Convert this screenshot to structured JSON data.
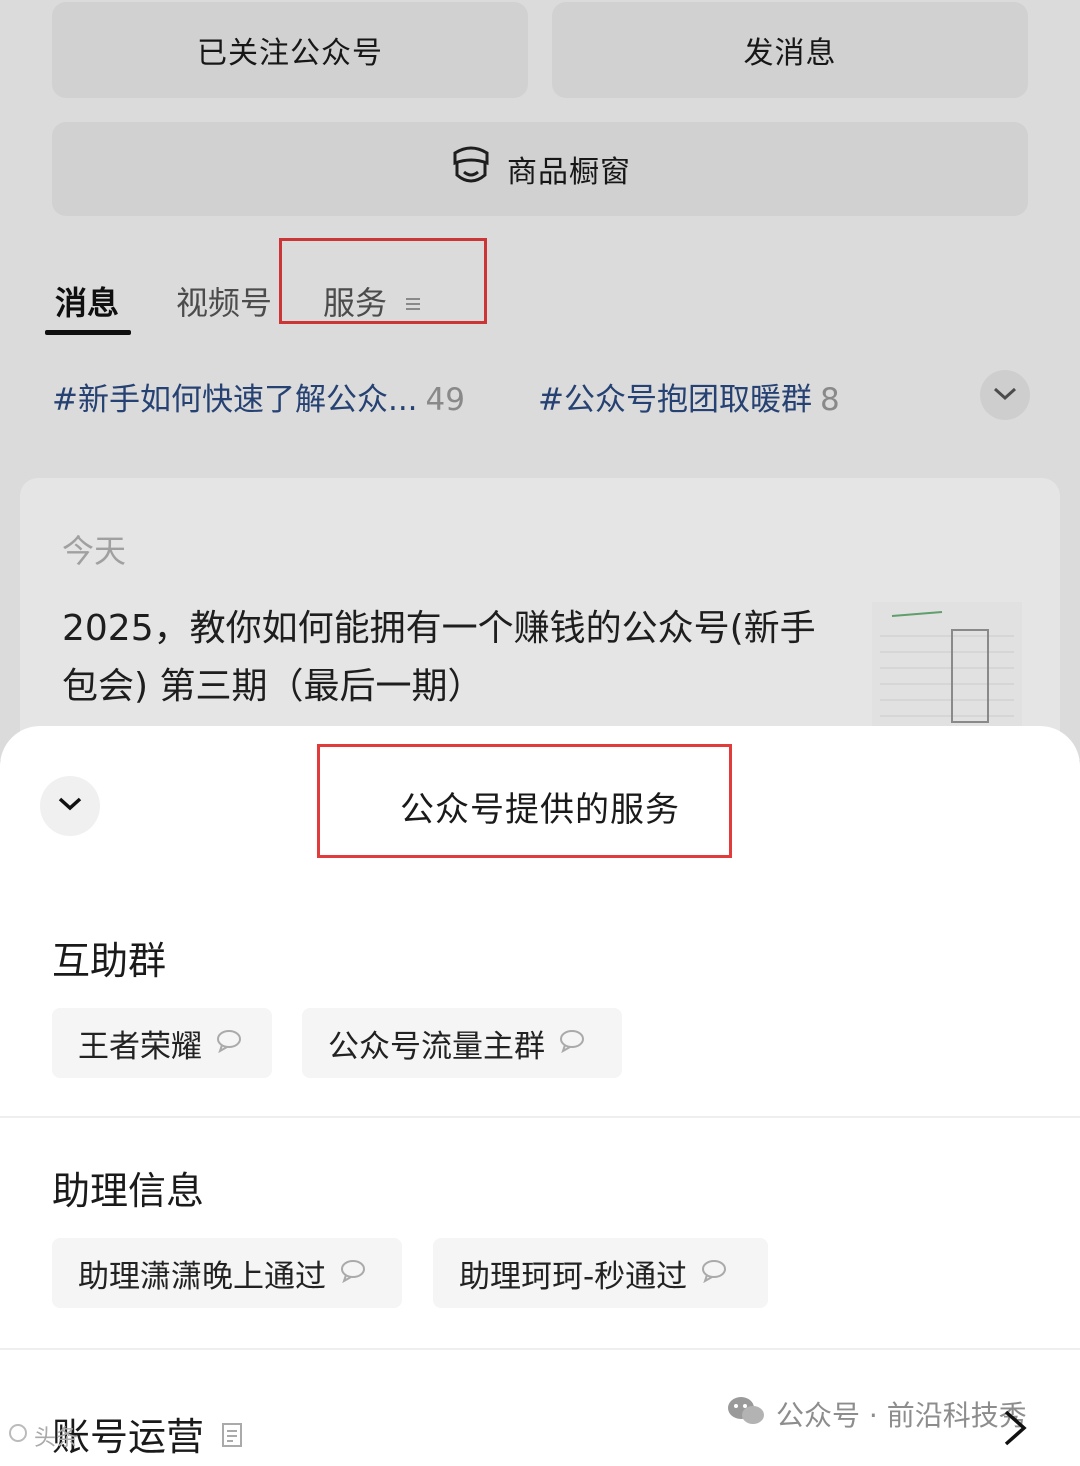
{
  "header": {
    "follow_label": "已关注公众号",
    "message_label": "发消息",
    "shop_label": "商品橱窗"
  },
  "tabs": [
    {
      "label": "消息",
      "active": true
    },
    {
      "label": "视频号",
      "active": false
    },
    {
      "label": "服务",
      "active": false
    }
  ],
  "topic_tags": [
    {
      "label": "#新手如何快速了解公众...",
      "count": "49"
    },
    {
      "label": "#公众号抱团取暖群",
      "count": "8"
    }
  ],
  "article": {
    "date": "今天",
    "title": "2025，教你如何能拥有一个赚钱的公众号(新手包会) 第三期（最后一期）"
  },
  "sheet": {
    "title": "公众号提供的服务",
    "sections": [
      {
        "title": "互助群",
        "chips": [
          "王者荣耀",
          "公众号流量主群"
        ]
      },
      {
        "title": "助理信息",
        "chips": [
          "助理潇潇晚上通过",
          "助理珂珂-秒通过"
        ]
      },
      {
        "title": "账号运营",
        "chips": []
      }
    ]
  },
  "watermark": {
    "right_text": "公众号 · 前沿科技秀",
    "left_text": "头条"
  },
  "colors": {
    "highlight_box": "#e23b3b",
    "tag_text": "#2b4a80"
  }
}
